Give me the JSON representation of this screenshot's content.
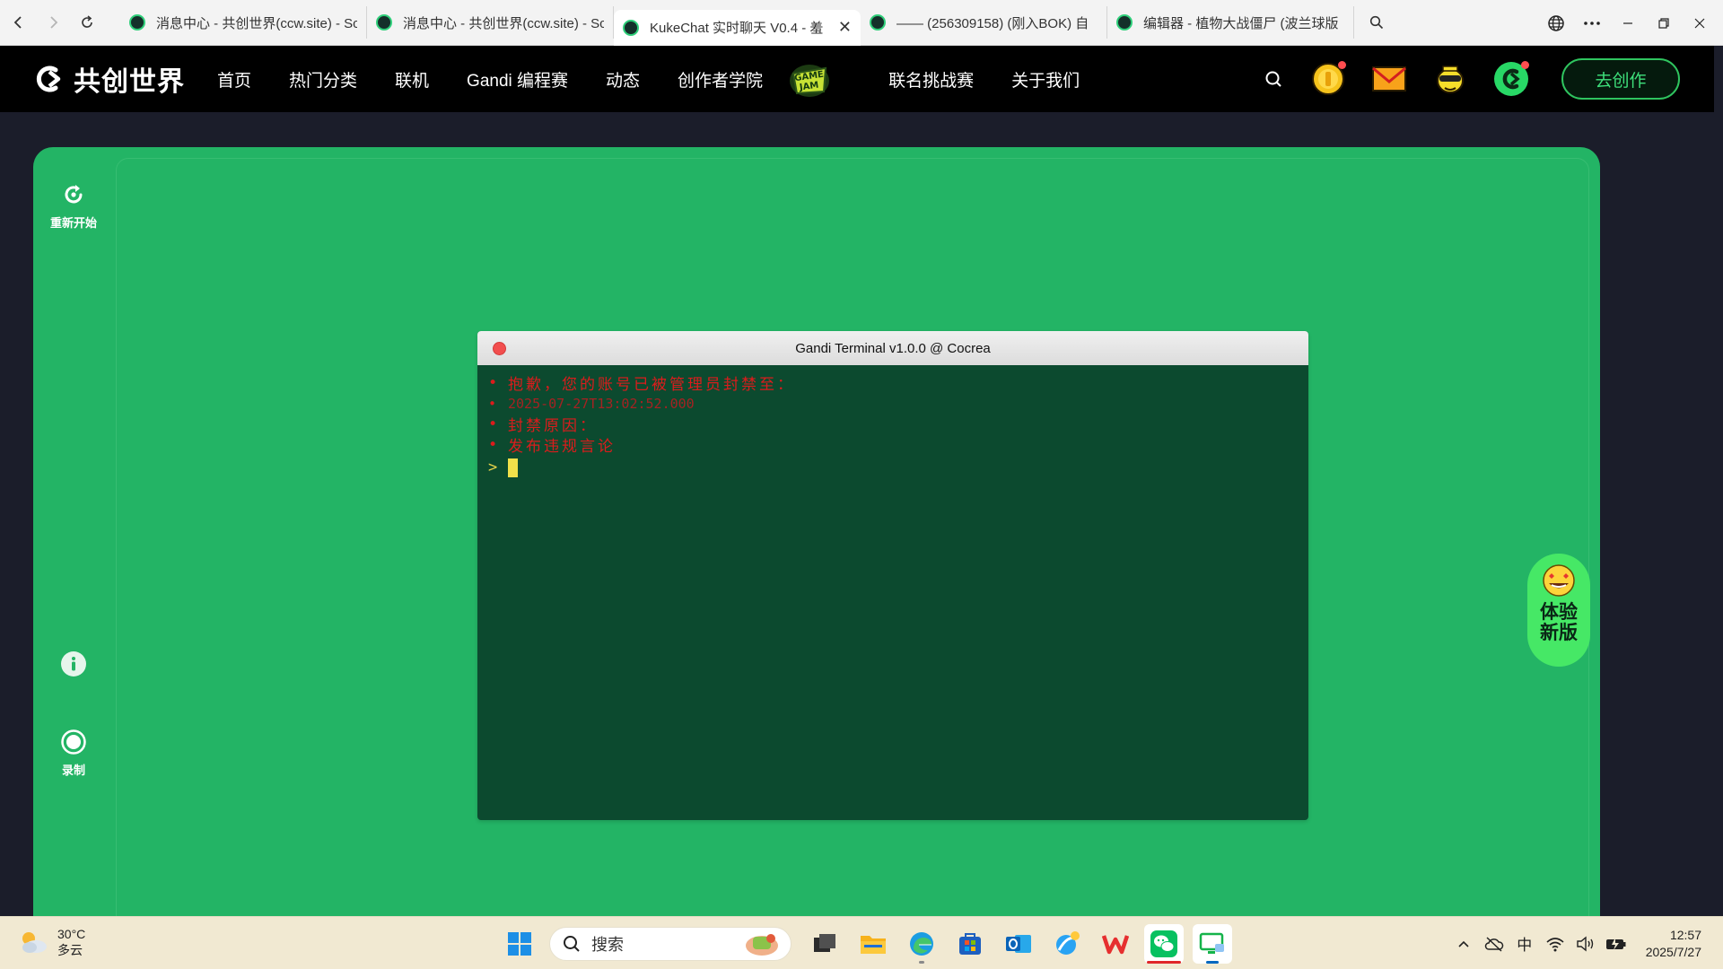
{
  "browser": {
    "tabs": [
      {
        "title": "消息中心 - 共创世界(ccw.site) - Sc",
        "active": false
      },
      {
        "title": "消息中心 - 共创世界(ccw.site) - Sc",
        "active": false
      },
      {
        "title": "KukeChat 实时聊天 V0.4 - 羞",
        "active": true
      },
      {
        "title": "—— (256309158) (刚入BOK) 自",
        "active": false
      },
      {
        "title": "编辑器 - 植物大战僵尸 (波兰球版",
        "active": false
      }
    ],
    "close_glyph": "✕"
  },
  "site": {
    "logo_text": "共创世界",
    "nav": [
      "首页",
      "热门分类",
      "联机",
      "Gandi 编程赛",
      "动态",
      "创作者学院",
      "联名挑战赛",
      "关于我们"
    ],
    "gamejam_label": "GAME JAM",
    "create_button": "去创作"
  },
  "sidebar": {
    "restart": "重新开始",
    "record": "录制"
  },
  "terminal": {
    "title": "Gandi Terminal v1.0.0 @ Cocrea",
    "lines": [
      {
        "text": "抱歉，您的账号已被管理员封禁至："
      },
      {
        "text": "2025-07-27T13:02:52.000"
      },
      {
        "text": "封禁原因："
      },
      {
        "text": "发布违规言论"
      }
    ],
    "bullet": "•",
    "prompt": ">"
  },
  "new_version": {
    "label": "体验新版"
  },
  "taskbar": {
    "weather_temp": "30°C",
    "weather_desc": "多云",
    "search_placeholder": "搜索",
    "time": "12:57",
    "date": "2025/7/27",
    "ime": "中"
  },
  "colors": {
    "panel_green": "#23b465",
    "terminal_bg": "#0c4a2f",
    "error_red": "#dc1c1c",
    "cursor_yellow": "#f1e04a",
    "accent_green": "#3ee07b"
  }
}
